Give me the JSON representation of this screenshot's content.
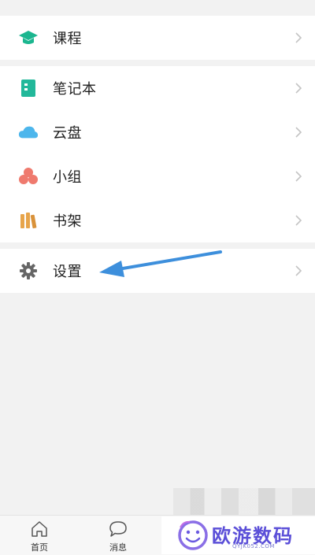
{
  "menu": {
    "course": {
      "label": "课程",
      "icon": "graduation-cap-icon",
      "color": "#1bb68f"
    },
    "notebook": {
      "label": "笔记本",
      "icon": "notebook-icon",
      "color": "#22b89a"
    },
    "cloud": {
      "label": "云盘",
      "icon": "cloud-icon",
      "color": "#4db6ec"
    },
    "group": {
      "label": "小组",
      "icon": "group-icon",
      "color": "#ef7a6e"
    },
    "bookshelf": {
      "label": "书架",
      "icon": "bookshelf-icon",
      "color": "#e7a44a"
    },
    "settings": {
      "label": "设置",
      "icon": "gear-icon",
      "color": "#666666"
    }
  },
  "tabbar": {
    "home": {
      "label": "首页",
      "icon": "home-icon"
    },
    "messages": {
      "label": "消息",
      "icon": "chat-bubble-icon"
    }
  },
  "watermark": {
    "title": "欧游数码",
    "subtitle": "QYJK052.COM"
  },
  "annotation": {
    "arrow_color": "#3d8fdc"
  }
}
